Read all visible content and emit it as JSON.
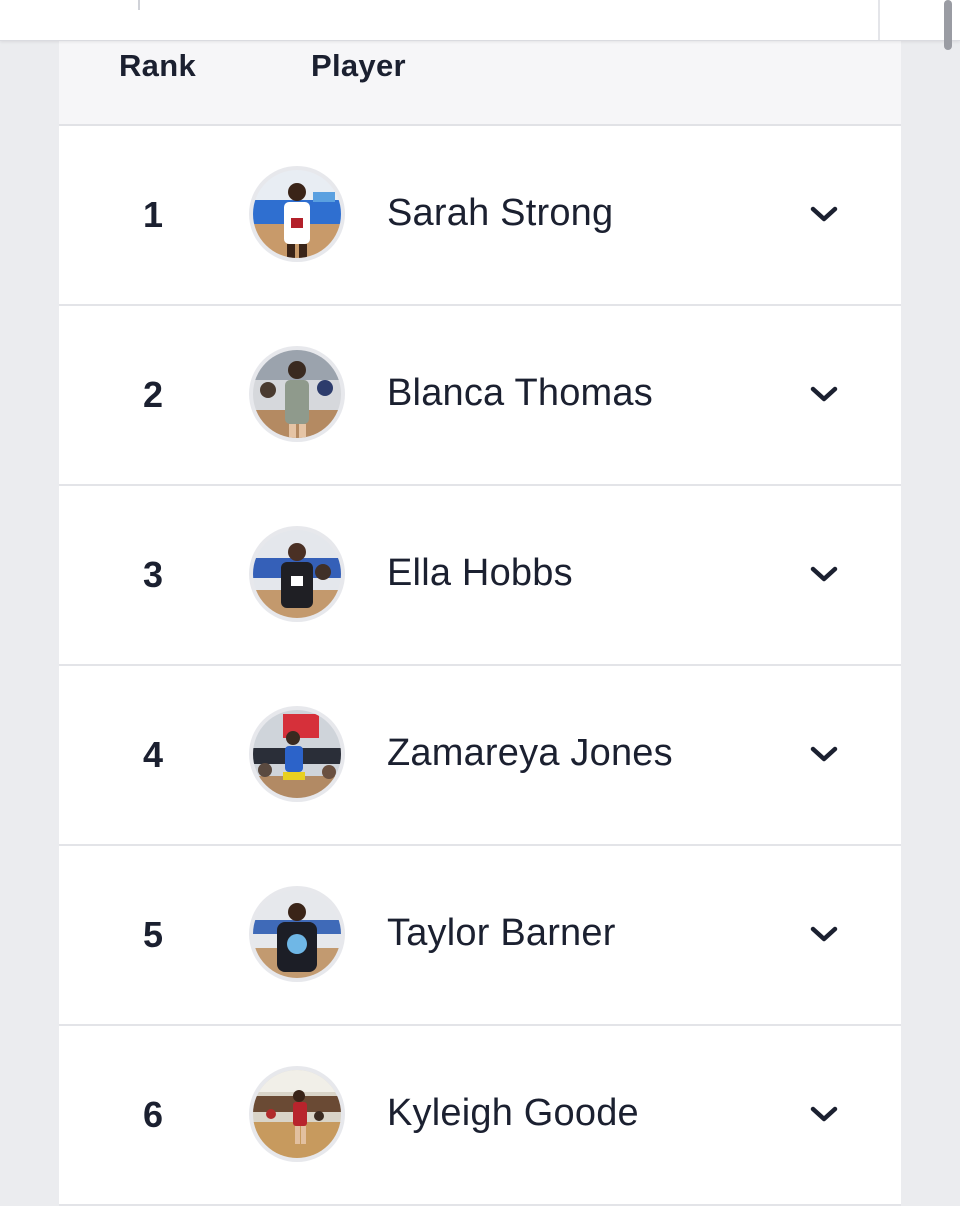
{
  "table": {
    "headers": {
      "rank": "Rank",
      "player": "Player"
    },
    "rows": [
      {
        "rank": "1",
        "name": "Sarah Strong",
        "avatar_icon": "player-photo"
      },
      {
        "rank": "2",
        "name": "Blanca Thomas",
        "avatar_icon": "player-photo"
      },
      {
        "rank": "3",
        "name": "Ella Hobbs",
        "avatar_icon": "player-photo"
      },
      {
        "rank": "4",
        "name": "Zamareya Jones",
        "avatar_icon": "player-photo"
      },
      {
        "rank": "5",
        "name": "Taylor Barner",
        "avatar_icon": "player-photo"
      },
      {
        "rank": "6",
        "name": "Kyleigh Goode",
        "avatar_icon": "player-photo"
      }
    ],
    "expand_icon": "chevron-down-icon"
  },
  "colors": {
    "text": "#1b2030",
    "background": "#ebecef",
    "header_bg": "#f6f6f8",
    "row_bg": "#ffffff",
    "divider": "#e3e4e8"
  }
}
